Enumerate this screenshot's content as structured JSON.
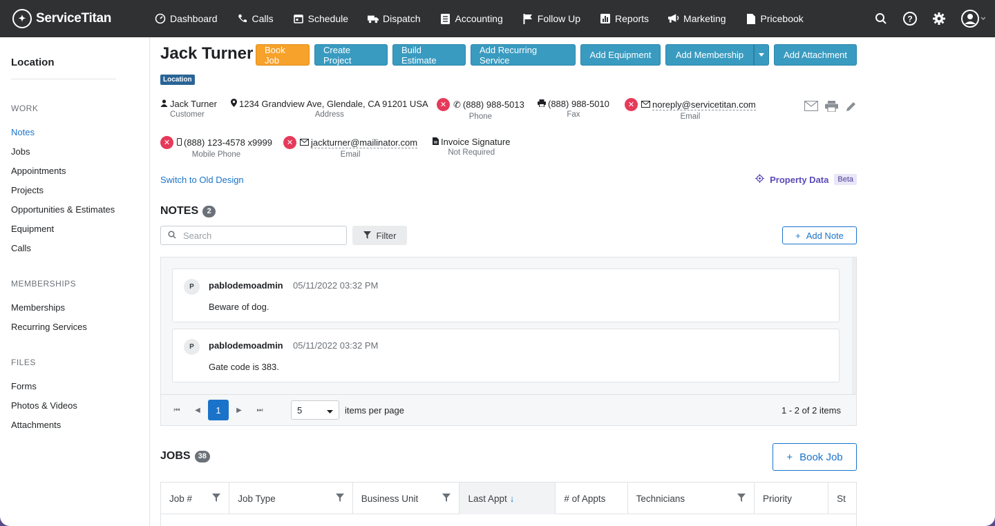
{
  "app": {
    "name": "ServiceTitan"
  },
  "nav": {
    "items": [
      {
        "label": "Dashboard",
        "icon": "dashboard-icon"
      },
      {
        "label": "Calls",
        "icon": "phone-icon"
      },
      {
        "label": "Schedule",
        "icon": "calendar-icon"
      },
      {
        "label": "Dispatch",
        "icon": "truck-icon"
      },
      {
        "label": "Accounting",
        "icon": "ledger-icon"
      },
      {
        "label": "Follow Up",
        "icon": "flag-icon"
      },
      {
        "label": "Reports",
        "icon": "bar-chart-icon"
      },
      {
        "label": "Marketing",
        "icon": "megaphone-icon"
      },
      {
        "label": "Pricebook",
        "icon": "book-icon"
      }
    ]
  },
  "sidebar": {
    "title": "Location",
    "work_label": "WORK",
    "work_items": [
      "Notes",
      "Jobs",
      "Appointments",
      "Projects",
      "Opportunities & Estimates",
      "Equipment",
      "Calls"
    ],
    "memberships_label": "MEMBERSHIPS",
    "membership_items": [
      "Memberships",
      "Recurring Services"
    ],
    "files_label": "FILES",
    "file_items": [
      "Forms",
      "Photos & Videos",
      "Attachments"
    ]
  },
  "header": {
    "name": "Jack Turner",
    "badge": "Location",
    "actions": {
      "book_job": "Book Job",
      "create_project": "Create Project",
      "build_estimate": "Build Estimate",
      "add_recurring": "Add Recurring Service",
      "add_equipment": "Add Equipment",
      "add_membership": "Add Membership",
      "add_attachment": "Add Attachment"
    }
  },
  "contact": {
    "customer": {
      "value": "Jack Turner",
      "label": "Customer"
    },
    "address": {
      "value": "1234 Grandview Ave, Glendale, CA 91201 USA",
      "label": "Address"
    },
    "phone": {
      "value": "(888) 988-5013",
      "label": "Phone"
    },
    "fax": {
      "value": "(888) 988-5010",
      "label": "Fax"
    },
    "email": {
      "value": "noreply@servicetitan.com",
      "label": "Email"
    },
    "mobile": {
      "value": "(888) 123-4578 x9999",
      "label": "Mobile Phone"
    },
    "email2": {
      "value": "jackturner@mailinator.com",
      "label": "Email"
    },
    "invoice": {
      "value": "Invoice Signature",
      "label": "Not Required"
    }
  },
  "links": {
    "switch_design": "Switch to Old Design",
    "property_data": "Property Data",
    "beta": "Beta"
  },
  "notes": {
    "title": "NOTES",
    "count": "2",
    "search_placeholder": "Search",
    "filter_label": "Filter",
    "add_label": "Add Note",
    "items": [
      {
        "initial": "P",
        "author": "pablodemoadmin",
        "time": "05/11/2022 03:32 PM",
        "body": "Beware of dog."
      },
      {
        "initial": "P",
        "author": "pablodemoadmin",
        "time": "05/11/2022 03:32 PM",
        "body": "Gate code is 383."
      }
    ],
    "pager": {
      "current_page": "1",
      "page_size": "5",
      "per_page_label": "items per page",
      "summary": "1 - 2 of 2 items"
    }
  },
  "jobs": {
    "title": "JOBS",
    "count": "38",
    "book_label": "Book Job",
    "columns": [
      "Job #",
      "Job Type",
      "Business Unit",
      "Last Appt",
      "# of Appts",
      "Technicians",
      "Priority",
      "St"
    ]
  }
}
